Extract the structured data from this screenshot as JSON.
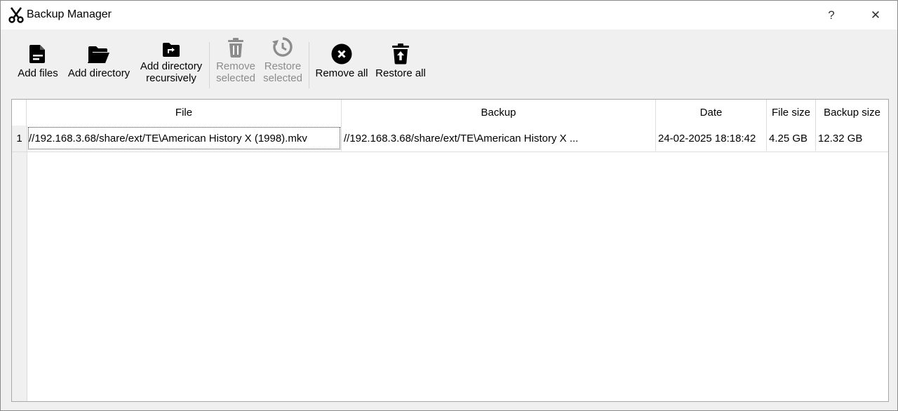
{
  "window": {
    "title": "Backup Manager",
    "help_label": "?",
    "close_label": "✕"
  },
  "toolbar": {
    "add_files": "Add files",
    "add_directory": "Add directory",
    "add_directory_recursively_line1": "Add directory",
    "add_directory_recursively_line2": "recursively",
    "remove_selected_line1": "Remove",
    "remove_selected_line2": "selected",
    "restore_selected_line1": "Restore",
    "restore_selected_line2": "selected",
    "remove_all": "Remove all",
    "restore_all": "Restore all"
  },
  "table": {
    "columns": [
      "File",
      "Backup",
      "Date",
      "File size",
      "Backup size"
    ],
    "rows": [
      {
        "num": "1",
        "file": "//192.168.3.68/share/ext/TE\\American History X (1998).mkv",
        "backup": "//192.168.3.68/share/ext/TE\\American History X ...",
        "date": "24-02-2025 18:18:42",
        "file_size": "4.25 GB",
        "backup_size": "12.32 GB"
      }
    ]
  },
  "icons": {
    "app": "scissors-icon",
    "add_files": "file-icon",
    "add_directory": "folder-open-icon",
    "add_directory_recursively": "folder-arrow-icon",
    "remove_selected": "trash-icon",
    "restore_selected": "history-icon",
    "remove_all": "x-circle-icon",
    "restore_all": "trash-restore-icon"
  },
  "colors": {
    "disabled_text": "#8c8c8c",
    "icon": "#000000",
    "icon_disabled": "#8c8c8c"
  }
}
